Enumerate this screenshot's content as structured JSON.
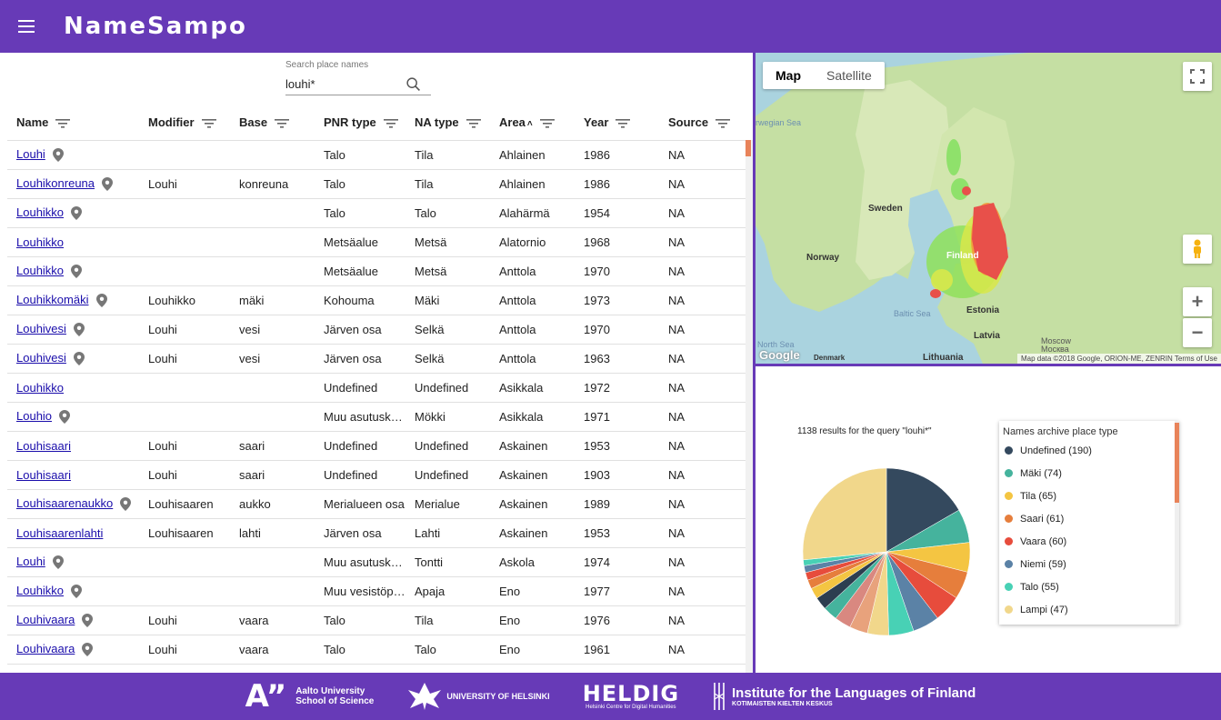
{
  "app": {
    "title": "NameSampo"
  },
  "search": {
    "label": "Search place names",
    "value": "louhi*"
  },
  "table": {
    "columns": [
      {
        "label": "Name",
        "sort": ""
      },
      {
        "label": "Modifier",
        "sort": ""
      },
      {
        "label": "Base",
        "sort": ""
      },
      {
        "label": "PNR type",
        "sort": ""
      },
      {
        "label": "NA type",
        "sort": ""
      },
      {
        "label": "Area",
        "sort": "˄"
      },
      {
        "label": "Year",
        "sort": ""
      },
      {
        "label": "Source",
        "sort": ""
      }
    ],
    "rows": [
      {
        "name": "Louhi",
        "pin": true,
        "modifier": "",
        "base": "",
        "pnr": "Talo",
        "na": "Tila",
        "area": "Ahlainen",
        "year": "1986",
        "source": "NA"
      },
      {
        "name": "Louhikonreuna",
        "pin": true,
        "modifier": "Louhi",
        "base": "konreuna",
        "pnr": "Talo",
        "na": "Tila",
        "area": "Ahlainen",
        "year": "1986",
        "source": "NA"
      },
      {
        "name": "Louhikko",
        "pin": true,
        "modifier": "",
        "base": "",
        "pnr": "Talo",
        "na": "Talo",
        "area": "Alahärmä",
        "year": "1954",
        "source": "NA"
      },
      {
        "name": "Louhikko",
        "pin": false,
        "modifier": "",
        "base": "",
        "pnr": "Metsäalue",
        "na": "Metsä",
        "area": "Alatornio",
        "year": "1968",
        "source": "NA"
      },
      {
        "name": "Louhikko",
        "pin": true,
        "modifier": "",
        "base": "",
        "pnr": "Metsäalue",
        "na": "Metsä",
        "area": "Anttola",
        "year": "1970",
        "source": "NA"
      },
      {
        "name": "Louhikkomäki",
        "pin": true,
        "modifier": "Louhikko",
        "base": "mäki",
        "pnr": "Kohouma",
        "na": "Mäki",
        "area": "Anttola",
        "year": "1973",
        "source": "NA"
      },
      {
        "name": "Louhivesi",
        "pin": true,
        "modifier": "Louhi",
        "base": "vesi",
        "pnr": "Järven osa",
        "na": "Selkä",
        "area": "Anttola",
        "year": "1970",
        "source": "NA"
      },
      {
        "name": "Louhivesi",
        "pin": true,
        "modifier": "Louhi",
        "base": "vesi",
        "pnr": "Järven osa",
        "na": "Selkä",
        "area": "Anttola",
        "year": "1963",
        "source": "NA"
      },
      {
        "name": "Louhikko",
        "pin": false,
        "modifier": "",
        "base": "",
        "pnr": "Undefined",
        "na": "Undefined",
        "area": "Asikkala",
        "year": "1972",
        "source": "NA"
      },
      {
        "name": "Louhio",
        "pin": true,
        "modifier": "",
        "base": "",
        "pnr": "Muu asutusko...",
        "na": "Mökki",
        "area": "Asikkala",
        "year": "1971",
        "source": "NA"
      },
      {
        "name": "Louhisaari",
        "pin": false,
        "modifier": "Louhi",
        "base": "saari",
        "pnr": "Undefined",
        "na": "Undefined",
        "area": "Askainen",
        "year": "1953",
        "source": "NA"
      },
      {
        "name": "Louhisaari",
        "pin": false,
        "modifier": "Louhi",
        "base": "saari",
        "pnr": "Undefined",
        "na": "Undefined",
        "area": "Askainen",
        "year": "1903",
        "source": "NA"
      },
      {
        "name": "Louhisaarenaukko",
        "pin": true,
        "modifier": "Louhisaaren",
        "base": "aukko",
        "pnr": "Merialueen osa",
        "na": "Merialue",
        "area": "Askainen",
        "year": "1989",
        "source": "NA"
      },
      {
        "name": "Louhisaarenlahti",
        "pin": false,
        "modifier": "Louhisaaren",
        "base": "lahti",
        "pnr": "Järven osa",
        "na": "Lahti",
        "area": "Askainen",
        "year": "1953",
        "source": "NA"
      },
      {
        "name": "Louhi",
        "pin": true,
        "modifier": "",
        "base": "",
        "pnr": "Muu asutusko...",
        "na": "Tontti",
        "area": "Askola",
        "year": "1974",
        "source": "NA"
      },
      {
        "name": "Louhikko",
        "pin": true,
        "modifier": "",
        "base": "",
        "pnr": "Muu vesistöpa...",
        "na": "Apaja",
        "area": "Eno",
        "year": "1977",
        "source": "NA"
      },
      {
        "name": "Louhivaara",
        "pin": true,
        "modifier": "Louhi",
        "base": "vaara",
        "pnr": "Talo",
        "na": "Tila",
        "area": "Eno",
        "year": "1976",
        "source": "NA"
      },
      {
        "name": "Louhivaara",
        "pin": true,
        "modifier": "Louhi",
        "base": "vaara",
        "pnr": "Talo",
        "na": "Talo",
        "area": "Eno",
        "year": "1961",
        "source": "NA"
      }
    ]
  },
  "map": {
    "type_buttons": [
      "Map",
      "Satellite"
    ],
    "active_type": "Map",
    "labels": [
      {
        "text": "rwegian Sea",
        "style": "light"
      },
      {
        "text": "Sweden",
        "style": "bold"
      },
      {
        "text": "Norway",
        "style": "bold"
      },
      {
        "text": "Finland",
        "style": "bold"
      },
      {
        "text": "Baltic Sea",
        "style": "light"
      },
      {
        "text": "Estonia",
        "style": "bold"
      },
      {
        "text": "Latvia",
        "style": "bold"
      },
      {
        "text": "Lithuania",
        "style": "bold"
      },
      {
        "text": "North Sea",
        "style": "light"
      },
      {
        "text": "Denmark",
        "style": "bold"
      },
      {
        "text": "Moscow",
        "style": "light"
      },
      {
        "text": "Москва",
        "style": "light"
      }
    ],
    "google_logo": "Google",
    "attribution": "Map data ©2018 Google, ORION-ME, ZENRIN   Terms of Use",
    "zoom_in": "+",
    "zoom_out": "−"
  },
  "chart_data": {
    "type": "pie",
    "title": "1138 results for the query \"louhi*\"",
    "legend_title": "Names archive place type",
    "total": 1138,
    "slices": [
      {
        "label": "Undefined",
        "value": 190,
        "color": "#34495e"
      },
      {
        "label": "Mäki",
        "value": 74,
        "color": "#45b39d"
      },
      {
        "label": "Tila",
        "value": 65,
        "color": "#f4c542"
      },
      {
        "label": "Saari",
        "value": 61,
        "color": "#e67e3c"
      },
      {
        "label": "Vaara",
        "value": 60,
        "color": "#e74c3c"
      },
      {
        "label": "Niemi",
        "value": 59,
        "color": "#5b82a6"
      },
      {
        "label": "Talo",
        "value": 55,
        "color": "#48d1b5"
      },
      {
        "label": "Lampi",
        "value": 47,
        "color": "#f1d78b"
      },
      {
        "label": "",
        "value": 40,
        "color": "#e8a27c"
      },
      {
        "label": "",
        "value": 36,
        "color": "#d98880"
      },
      {
        "label": "",
        "value": 32,
        "color": "#45b39d"
      },
      {
        "label": "",
        "value": 28,
        "color": "#2c3e50"
      },
      {
        "label": "",
        "value": 24,
        "color": "#f4c542"
      },
      {
        "label": "",
        "value": 20,
        "color": "#e67e3c"
      },
      {
        "label": "",
        "value": 17,
        "color": "#e74c3c"
      },
      {
        "label": "",
        "value": 15,
        "color": "#5b82a6"
      },
      {
        "label": "",
        "value": 13,
        "color": "#48d1b5"
      },
      {
        "label": "",
        "value": 302,
        "color": "#f1d78b"
      }
    ],
    "legend_visible": 8
  },
  "footer": {
    "aalto_mark": "A”",
    "aalto_line1": "Aalto University",
    "aalto_line2": "School of Science",
    "uh": "UNIVERSITY OF HELSINKI",
    "heldig": "HELDIG",
    "heldig_sub": "Helsinki Centre for Digital Humanities",
    "kotus": "Institute for the Languages of Finland",
    "kotus_sub": "KOTIMAISTEN KIELTEN KESKUS"
  },
  "colors": {
    "brand": "#673ab7",
    "link": "#1a0dab",
    "accent": "#e8835a"
  }
}
